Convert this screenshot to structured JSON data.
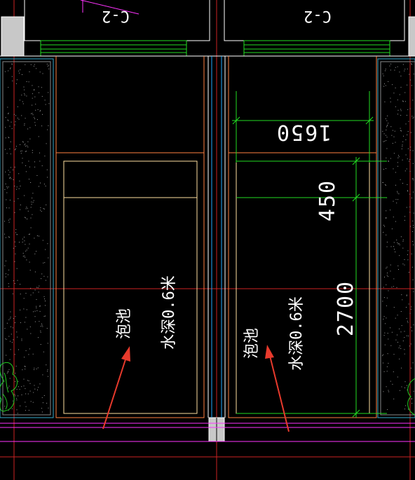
{
  "drawing": {
    "background": "#000000",
    "colors": {
      "wall_orange": "#ff8040",
      "cream": "#ffe0a0",
      "green": "#22dd22",
      "magenta": "#ff33ff",
      "red_axis": "#cc2222",
      "cyan": "#33aacc",
      "gray_column": "#c8c8c8",
      "white": "#ffffff",
      "arrow_red": "#e83a2c"
    },
    "window_tags": {
      "left": "C-2",
      "right": "C-2"
    },
    "dimensions": {
      "width": "1650",
      "short": "450",
      "long": "2700"
    },
    "pools": {
      "left": {
        "name": "泡池",
        "depth": "水深0.6米"
      },
      "right": {
        "name": "泡池",
        "depth": "水深0.6米"
      }
    }
  }
}
